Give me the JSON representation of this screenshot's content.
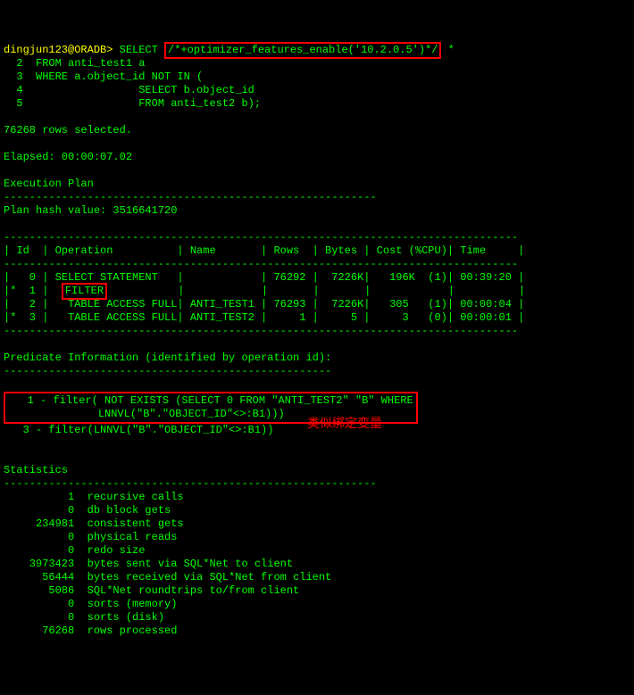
{
  "prompt": "dingjun123@ORADB>",
  "sql_cmd": " SELECT ",
  "hint_box": "/*+optimizer_features_enable('10.2.0.5')*/",
  "hint_tail": " *",
  "sql_l2": "  2  FROM anti_test1 a",
  "sql_l3": "  3  WHERE a.object_id NOT IN (",
  "sql_l4": "  4                  SELECT b.object_id",
  "sql_l5": "  5                  FROM anti_test2 b);",
  "rows_sel": "76268 rows selected.",
  "elapsed": "Elapsed: 00:00:07.02",
  "exec_plan_hdr": "Execution Plan",
  "dash58": "----------------------------------------------------------",
  "plan_hash": "Plan hash value: 3516641720",
  "dash_long": "--------------------------------------------------------------------------------",
  "plan_hdr": "| Id  | Operation          | Name       | Rows  | Bytes | Cost (%CPU)| Time     |",
  "plan_r0": "|   0 | SELECT STATEMENT   |            | 76292 |  7226K|   196K  (1)| 00:39:20 |",
  "plan_r1_pre": "|*  1 |  ",
  "plan_r1_box": "FILTER",
  "plan_r1_post": "           |            |       |       |            |          |",
  "plan_r2": "|   2 |   TABLE ACCESS FULL| ANTI_TEST1 | 76293 |  7226K|   305   (1)| 00:00:04 |",
  "plan_r3": "|*  3 |   TABLE ACCESS FULL| ANTI_TEST2 |     1 |     5 |     3   (0)| 00:00:01 |",
  "pred_hdr": "Predicate Information (identified by operation id):",
  "dash51": "---------------------------------------------------",
  "pred_l1": "   1 - filter( NOT EXISTS (SELECT 0 FROM \"ANTI_TEST2\" \"B\" WHERE",
  "pred_l2": "              LNNVL(\"B\".\"OBJECT_ID\"<>:B1)))",
  "pred_l3": "   3 - filter(LNNVL(\"B\".\"OBJECT_ID\"<>:B1))",
  "anno_text": "类似绑定变量",
  "stats_hdr": "Statistics",
  "st1": "          1  recursive calls",
  "st2": "          0  db block gets",
  "st3": "     234981  consistent gets",
  "st4": "          0  physical reads",
  "st5": "          0  redo size",
  "st6": "    3973423  bytes sent via SQL*Net to client",
  "st7": "      56444  bytes received via SQL*Net from client",
  "st8": "       5086  SQL*Net roundtrips to/from client",
  "st9": "          0  sorts (memory)",
  "st10": "          0  sorts (disk)",
  "st11": "      76268  rows processed"
}
